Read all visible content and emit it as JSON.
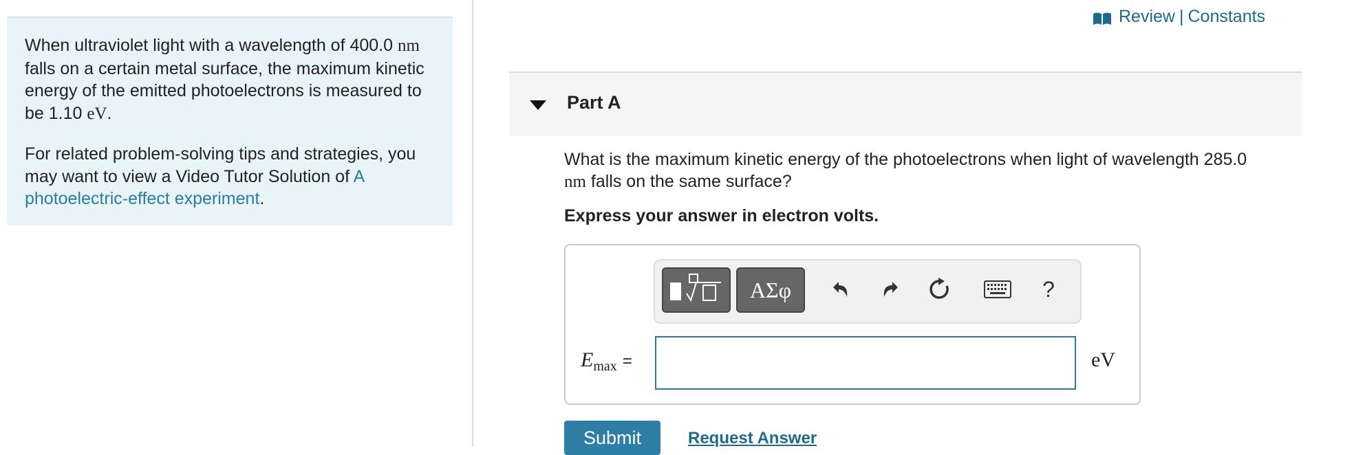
{
  "problem": {
    "para1": {
      "t1": "When ultraviolet light with a wavelength of 400.0 ",
      "u1": "nm",
      "t2": " falls on a certain metal surface, the maximum kinetic energy of the emitted photoelectrons is measured to be 1.10 ",
      "u2": "eV",
      "t3": "."
    },
    "para2": {
      "t1": "For related problem-solving tips and strategies, you may want to view a Video Tutor Solution of ",
      "link": "A photoelectric-effect experiment",
      "t2": "."
    }
  },
  "header_links": {
    "review": "Review",
    "separator": "|",
    "constants": "Constants"
  },
  "part": {
    "title": "Part A"
  },
  "question": {
    "t1": "What is the maximum kinetic energy of the photoelectrons when light of wavelength 285.0 ",
    "unit": "nm",
    "t2": " falls on the same surface?",
    "instruction": "Express your answer in electron volts."
  },
  "answer": {
    "variable": "E",
    "subscript": "max",
    "equals": "=",
    "value": "",
    "unit": "eV"
  },
  "toolbar": {
    "symbols_label": "ΑΣφ",
    "help_label": "?",
    "icons": [
      "templates-icon",
      "greek-symbols-icon",
      "undo-icon",
      "redo-icon",
      "reset-icon",
      "keyboard-icon",
      "help-icon"
    ]
  },
  "buttons": {
    "submit": "Submit",
    "request_answer": "Request Answer"
  },
  "colors": {
    "link": "#1d6a8f",
    "panel_bg": "#e8f4f7",
    "submit_bg": "#2f7ea6",
    "input_border": "#2a7aa2"
  }
}
